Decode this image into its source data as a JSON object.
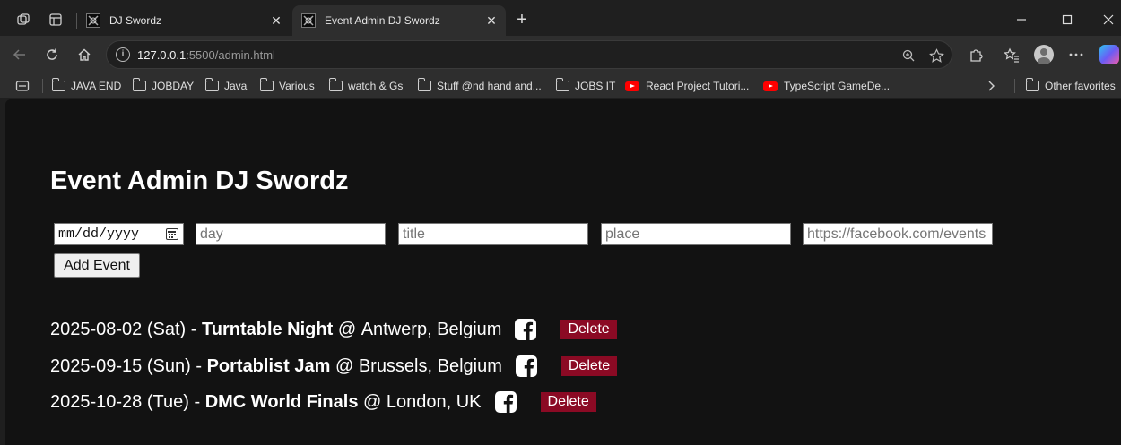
{
  "browser": {
    "tabs": [
      {
        "title": "DJ Swordz",
        "active": false
      },
      {
        "title": "Event Admin DJ Swordz",
        "active": true
      }
    ],
    "address": {
      "host": "127.0.0.1",
      "path": ":5500/admin.html"
    },
    "bookmarks": [
      {
        "label": "JAVA END",
        "icon": "folder-icon"
      },
      {
        "label": "JOBDAY",
        "icon": "folder-icon"
      },
      {
        "label": "Java",
        "icon": "folder-icon"
      },
      {
        "label": "Various",
        "icon": "folder-icon"
      },
      {
        "label": "watch & Gs",
        "icon": "folder-icon"
      },
      {
        "label": "Stuff @nd hand and...",
        "icon": "folder-icon"
      },
      {
        "label": "JOBS IT",
        "icon": "folder-icon"
      },
      {
        "label": "React Project Tutori...",
        "icon": "youtube-icon"
      },
      {
        "label": "TypeScript GameDe...",
        "icon": "youtube-icon"
      }
    ],
    "other_favorites": "Other favorites"
  },
  "page": {
    "title": "Event Admin DJ Swordz",
    "form": {
      "date_placeholder": "mm/dd/yyyy",
      "day_placeholder": "day",
      "title_placeholder": "title",
      "place_placeholder": "place",
      "link_placeholder": "https://facebook.com/events",
      "submit_label": "Add Event"
    },
    "events": [
      {
        "date": "2025-08-02",
        "day": "(Sat)",
        "title": "Turntable Night",
        "place": "Antwerp, Belgium"
      },
      {
        "date": "2025-09-15",
        "day": "(Sun)",
        "title": "Portablist Jam",
        "place": "Brussels, Belgium"
      },
      {
        "date": "2025-10-28",
        "day": "(Tue)",
        "title": "DMC World Finals",
        "place": "London, UK"
      }
    ],
    "delete_label": "Delete",
    "colors": {
      "background": "#121212",
      "delete_button": "#8b0a24",
      "text": "#ffffff"
    }
  }
}
